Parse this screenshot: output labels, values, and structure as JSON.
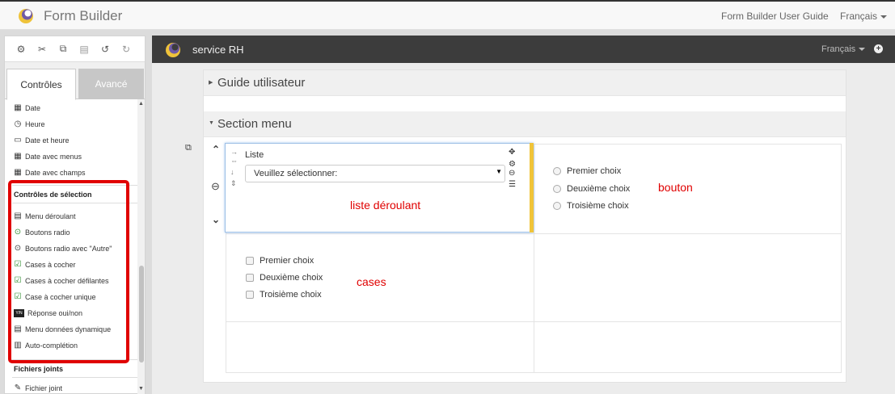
{
  "topbar": {
    "app_title": "Form Builder",
    "guide_link": "Form Builder User Guide",
    "language": "Français"
  },
  "toolbar": {
    "icons": [
      "settings-icon",
      "cut-icon",
      "copy-icon",
      "paste-icon",
      "undo-icon",
      "redo-icon"
    ]
  },
  "tabs": {
    "controls": "Contrôles",
    "advanced": "Avancé"
  },
  "controls": {
    "items_top": [
      "Date",
      "Heure",
      "Date et heure",
      "Date avec menus",
      "Date avec champs"
    ],
    "selection_header": "Contrôles de sélection",
    "selection_items": [
      "Menu déroulant",
      "Boutons radio",
      "Boutons radio avec \"Autre\"",
      "Cases à cocher",
      "Cases à cocher défilantes",
      "Case à cocher unique",
      "Réponse oui/non",
      "Menu données dynamique",
      "Auto-complétion"
    ],
    "attachments_header": "Fichiers joints",
    "attachments_items": [
      "Fichier joint"
    ]
  },
  "main": {
    "form_name": "service RH",
    "language": "Français",
    "section_guide": "Guide utilisateur",
    "section_menu": "Section menu",
    "list_label": "Liste",
    "list_placeholder": "Veuillez sélectionner:",
    "radio_choices": [
      "Premier choix",
      "Deuxième choix",
      "Troisième choix"
    ],
    "checkbox_choices": [
      "Premier choix",
      "Deuxième choix",
      "Troisième choix"
    ],
    "annotation_list": "liste déroulant",
    "annotation_radio": "bouton",
    "annotation_checkbox": "cases"
  },
  "colors": {
    "highlight_red": "#e00000",
    "selected_bar": "#f0c43a",
    "main_header": "#3c3c3c"
  }
}
